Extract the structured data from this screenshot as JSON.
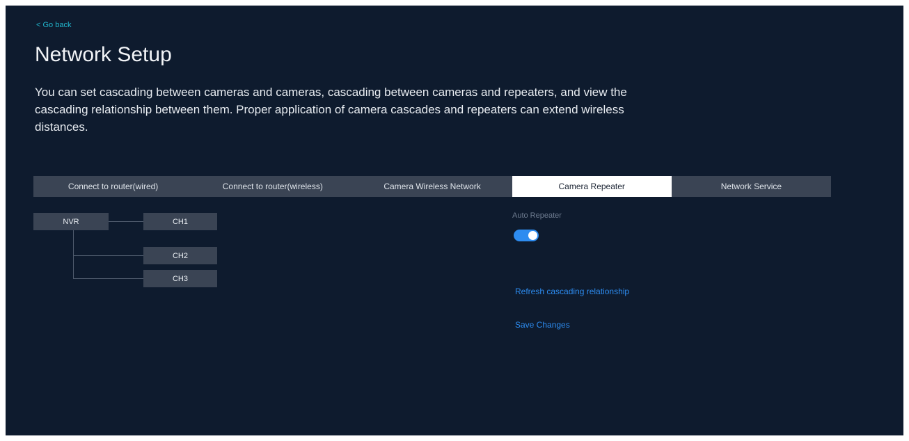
{
  "header": {
    "back_label": "< Go back",
    "title": "Network Setup",
    "description": "You can set cascading between cameras and cameras, cascading between cameras and repeaters, and view the cascading relationship between them. Proper application of camera cascades and repeaters can extend wireless distances."
  },
  "tabs": [
    {
      "label": "Connect to router(wired)",
      "active": false
    },
    {
      "label": "Connect to router(wireless)",
      "active": false
    },
    {
      "label": "Camera Wireless Network",
      "active": false
    },
    {
      "label": "Camera Repeater",
      "active": true
    },
    {
      "label": "Network Service",
      "active": false
    }
  ],
  "cascade": {
    "root": "NVR",
    "channels": [
      "CH1",
      "CH2",
      "CH3"
    ]
  },
  "repeater": {
    "auto_label": "Auto Repeater",
    "auto_enabled": true,
    "refresh_label": "Refresh cascading relationship",
    "save_label": "Save Changes"
  },
  "colors": {
    "background": "#0e1b2e",
    "accent": "#2d8cf0",
    "back_link": "#22b8cf",
    "tab_bg": "#3a4454",
    "tab_active_bg": "#ffffff"
  }
}
